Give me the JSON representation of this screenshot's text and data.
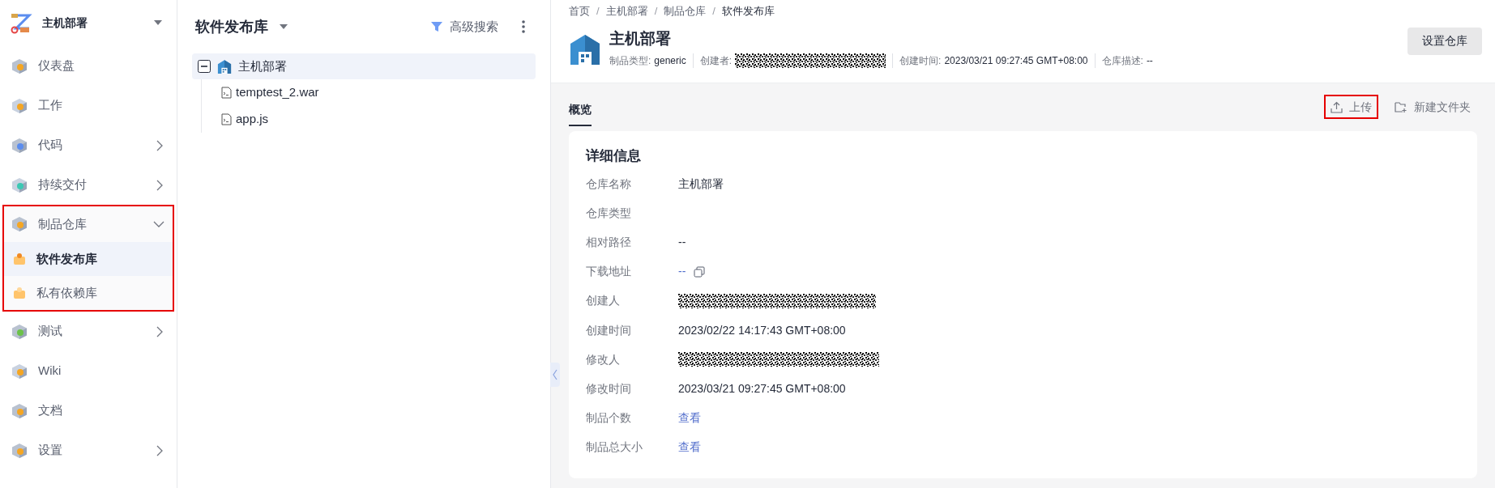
{
  "sidebar": {
    "project": "主机部署",
    "items": [
      {
        "label": "仪表盘",
        "kind": "plain"
      },
      {
        "label": "工作",
        "kind": "plain"
      },
      {
        "label": "代码",
        "kind": "expandable"
      },
      {
        "label": "持续交付",
        "kind": "expandable"
      },
      {
        "label": "制品仓库",
        "kind": "group",
        "expanded": true,
        "highlighted": true,
        "children": [
          {
            "label": "软件发布库",
            "selected": true
          },
          {
            "label": "私有依赖库",
            "selected": false
          }
        ]
      },
      {
        "label": "测试",
        "kind": "expandable"
      },
      {
        "label": "Wiki",
        "kind": "plain"
      },
      {
        "label": "文档",
        "kind": "plain"
      },
      {
        "label": "设置",
        "kind": "expandable"
      }
    ]
  },
  "tree_panel": {
    "title": "软件发布库",
    "search_button": "高级搜索",
    "tree": [
      {
        "label": "主机部署",
        "expanded": true,
        "selected": true,
        "children": [
          {
            "label": "temptest_2.war"
          },
          {
            "label": "app.js"
          }
        ]
      }
    ]
  },
  "breadcrumb": [
    {
      "label": "首页"
    },
    {
      "separator": "/",
      "label": "主机部署"
    },
    {
      "separator": "/",
      "label": "制品仓库"
    },
    {
      "separator": "/",
      "label": "软件发布库"
    }
  ],
  "repo": {
    "name": "主机部署",
    "meta": [
      {
        "label": "制品类型:",
        "value": "generic",
        "kind": "text"
      },
      {
        "label": "创建者:",
        "kind": "redacted"
      },
      {
        "label": "创建时间:",
        "value": "2023/03/21 09:27:45 GMT+08:00",
        "kind": "text"
      },
      {
        "label": "仓库描述:",
        "value": "--",
        "kind": "text"
      }
    ],
    "settings_button": "设置仓库"
  },
  "tabs": [
    {
      "label": "概览",
      "selected": true
    }
  ],
  "actions": [
    {
      "label": "上传",
      "highlighted": true
    },
    {
      "label": "新建文件夹",
      "highlighted": false
    }
  ],
  "details": {
    "title": "详细信息",
    "fields": [
      {
        "label": "仓库名称",
        "kind": "text",
        "value": "主机部署"
      },
      {
        "label": "仓库类型",
        "kind": "empty"
      },
      {
        "label": "相对路径",
        "kind": "text",
        "value": "--"
      },
      {
        "label": "下载地址",
        "kind": "copy_link",
        "value": "--"
      },
      {
        "label": "创建人",
        "kind": "redacted"
      },
      {
        "label": "创建时间",
        "kind": "text",
        "value": "2023/02/22 14:17:43 GMT+08:00"
      },
      {
        "label": "修改人",
        "kind": "redacted"
      },
      {
        "label": "修改时间",
        "kind": "text",
        "value": "2023/03/21 09:27:45 GMT+08:00"
      },
      {
        "label": "制品个数",
        "kind": "link",
        "value": "查看"
      },
      {
        "label": "制品总大小",
        "kind": "link",
        "value": "查看"
      }
    ]
  }
}
